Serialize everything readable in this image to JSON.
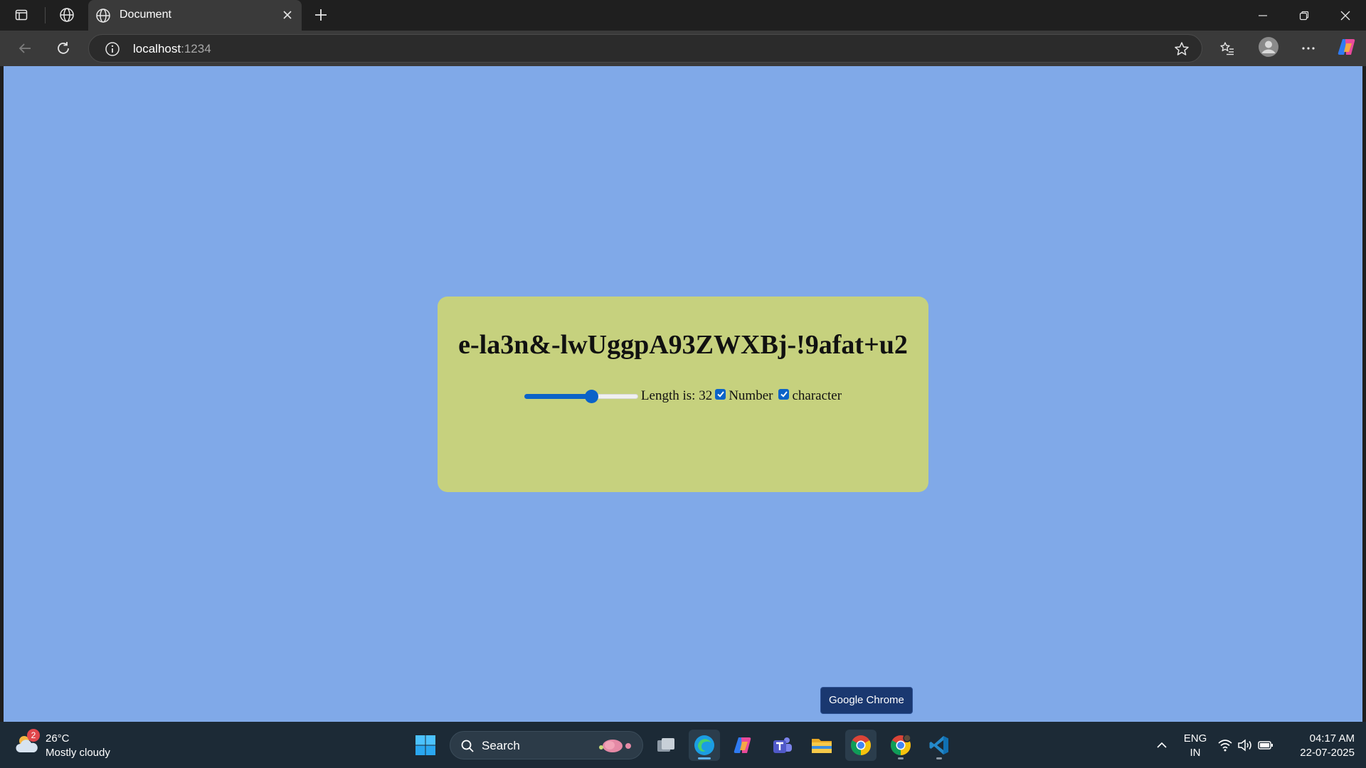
{
  "browser": {
    "tab": {
      "title": "Document"
    },
    "address": {
      "host": "localhost",
      "port": ":1234"
    }
  },
  "page": {
    "password": "e-la3n&-lwUggpA93ZWXBj-!9afat+u2",
    "length_label": "Length is: 32",
    "length_value": 32,
    "slider_fraction": 0.6,
    "number_label": "Number",
    "number_checked": true,
    "character_label": "character",
    "character_checked": true
  },
  "tooltip": {
    "text": "Google Chrome"
  },
  "taskbar": {
    "weather": {
      "badge": "2",
      "temp": "26°C",
      "desc": "Mostly cloudy"
    },
    "search": {
      "label": "Search"
    },
    "tray": {
      "lang1": "ENG",
      "lang2": "IN",
      "time": "04:17 AM",
      "date": "22-07-2025"
    }
  },
  "colors": {
    "page_background": "#80a9e8",
    "card_background": "#c6d17e",
    "accent": "#0b63c8"
  }
}
